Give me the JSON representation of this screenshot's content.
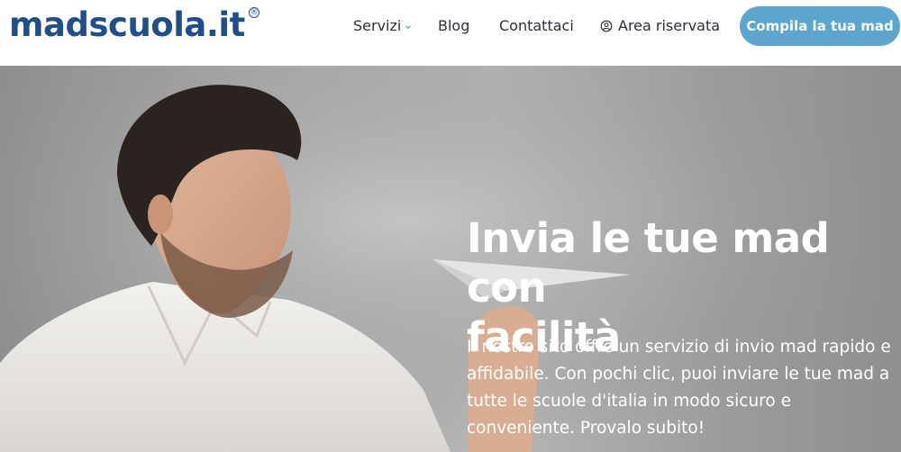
{
  "header": {
    "logo_text": "madscuola.it",
    "logo_mark": "®",
    "nav": {
      "servizi": "Servizi",
      "blog": "Blog",
      "contattaci": "Contattaci",
      "area_riservata": "Area riservata"
    },
    "cta_label": "Compila la tua mad"
  },
  "hero": {
    "title_line1": "Invia le tue mad con",
    "title_line2": "facilità",
    "text_line1": "Il nostro sito offre un servizio di invio mad rapido e",
    "text_line2": "affidabile. Con pochi clic, puoi inviare le tue mad a",
    "text_line3": "tutte le scuole d'italia in modo sicuro e",
    "text_line4": "conveniente. Provalo subito!"
  },
  "colors": {
    "brand": "#1e4f8d",
    "cta": "#5aa6ce",
    "nav_text": "#2a2f3a",
    "hero_text": "#ffffff"
  },
  "icons": [
    "chevron-down-icon",
    "user-circle-icon"
  ]
}
